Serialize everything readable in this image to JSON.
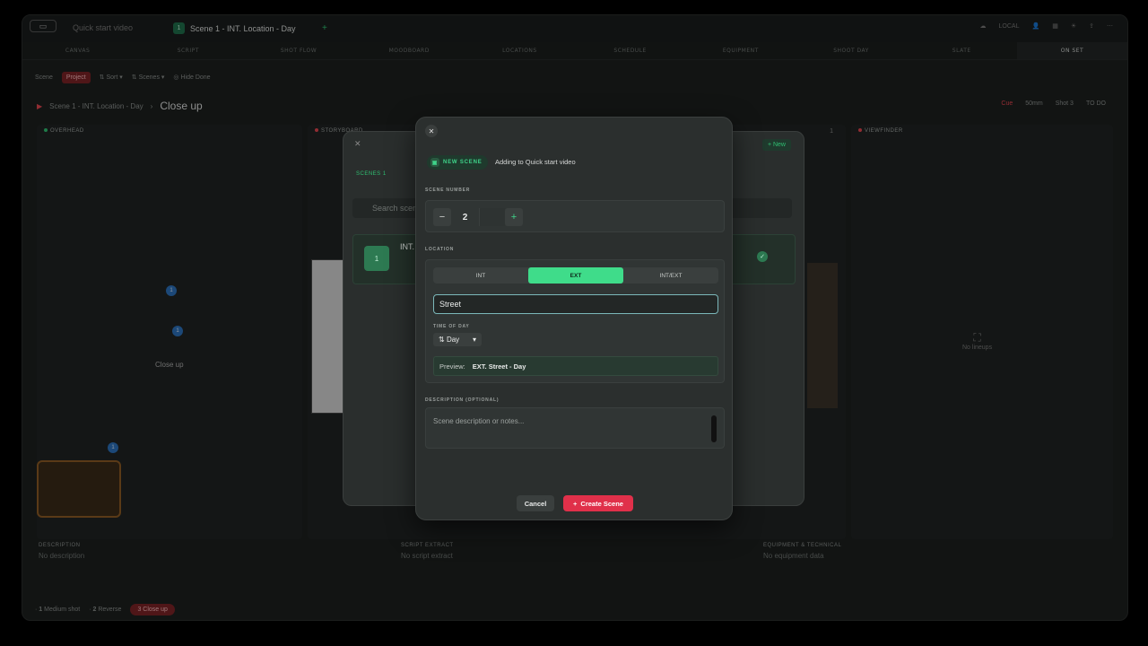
{
  "titlebar": {
    "project": "Quick start video",
    "scene_num": "1",
    "scene_title": "Scene 1 - INT. Location - Day",
    "local": "LOCAL"
  },
  "tabs": [
    "CANVAS",
    "SCRIPT",
    "SHOT FLOW",
    "MOODBOARD",
    "LOCATIONS",
    "SCHEDULE",
    "EQUIPMENT",
    "SHOOT DAY",
    "SLATE",
    "ON SET"
  ],
  "filterbar": {
    "scene": "Scene",
    "project": "Project",
    "sort": "Sort",
    "scenes": "Scenes",
    "hide_done": "Hide Done"
  },
  "crumb": {
    "scene": "Scene 1 - INT. Location - Day",
    "shot": "Close up"
  },
  "crumb_right": {
    "cue": "Cue",
    "lens": "50mm",
    "shot": "Shot 3",
    "todo": "TO DO"
  },
  "panels": {
    "overhead": "OVERHEAD",
    "storyboard": "STORYBOARD",
    "viewfinder": "VIEWFINDER",
    "storyboard_count": "1",
    "no_lineups": "No lineups",
    "close_up_label": "Close up"
  },
  "bottom": {
    "description_label": "DESCRIPTION",
    "description_val": "No description",
    "script_label": "SCRIPT EXTRACT",
    "script_val": "No script extract",
    "equip_label": "EQUIPMENT & TECHNICAL",
    "equip_val": "No equipment data"
  },
  "shots": [
    {
      "num": "1",
      "label": "Medium shot"
    },
    {
      "num": "2",
      "label": "Reverse"
    },
    {
      "num": "3",
      "label": "Close up"
    }
  ],
  "bg_modal": {
    "new": "New",
    "scenes": "SCENES",
    "scenes_count": "1",
    "search": "Search scenes...",
    "card_title": "INT.",
    "card_num": "1"
  },
  "modal": {
    "badge": "NEW SCENE",
    "adding": "Adding to Quick start video",
    "scene_number_label": "SCENE NUMBER",
    "scene_number": "2",
    "location_label": "LOCATION",
    "seg": [
      "INT",
      "EXT",
      "INT/EXT"
    ],
    "location_value": "Street",
    "tod_label": "TIME OF DAY",
    "tod": "Day",
    "preview_label": "Preview:",
    "preview_value": "EXT. Street - Day",
    "desc_label": "DESCRIPTION (OPTIONAL)",
    "desc_placeholder": "Scene description or notes...",
    "cancel": "Cancel",
    "create": "Create Scene"
  },
  "colors": {
    "accent_green": "#3fdc8a",
    "accent_red": "#e0304a",
    "bg": "#1c1f1e"
  }
}
